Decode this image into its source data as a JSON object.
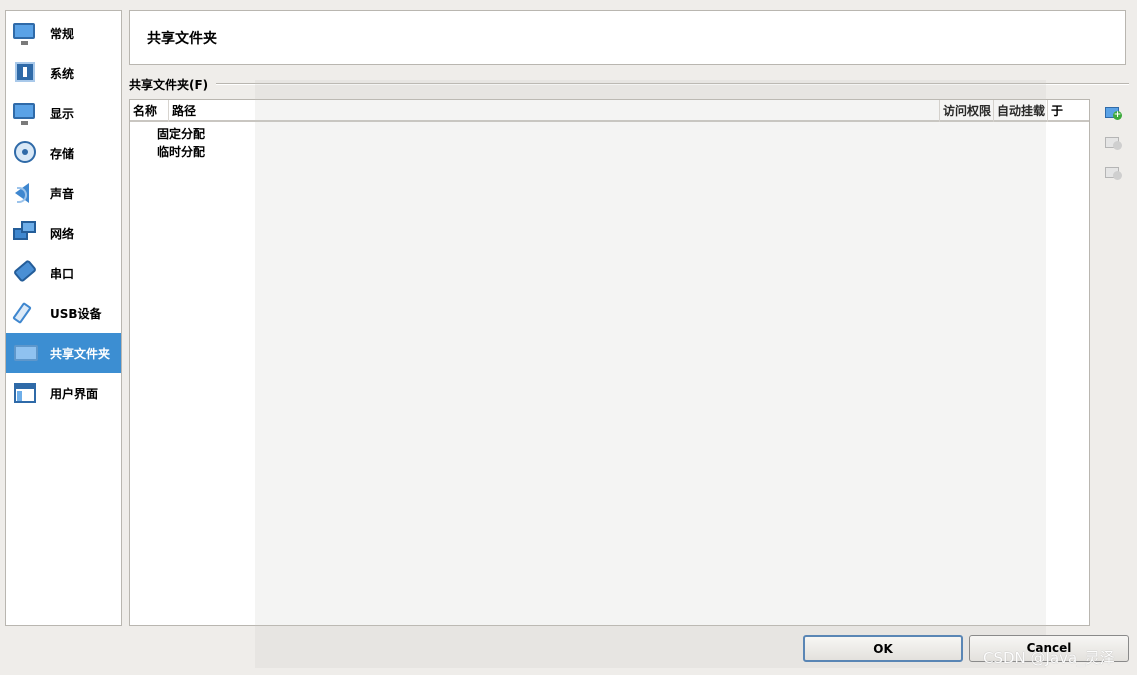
{
  "sidebar": {
    "items": [
      {
        "label": "常规",
        "icon": "monitor-icon"
      },
      {
        "label": "系统",
        "icon": "chip-icon"
      },
      {
        "label": "显示",
        "icon": "display-icon"
      },
      {
        "label": "存储",
        "icon": "disk-icon"
      },
      {
        "label": "声音",
        "icon": "speaker-icon"
      },
      {
        "label": "网络",
        "icon": "network-icon"
      },
      {
        "label": "串口",
        "icon": "serial-port-icon"
      },
      {
        "label": "USB设备",
        "icon": "usb-icon"
      },
      {
        "label": "共享文件夹",
        "icon": "shared-folder-icon",
        "selected": true
      },
      {
        "label": "用户界面",
        "icon": "window-icon"
      }
    ],
    "active_color": "#3c8ed2"
  },
  "header": {
    "title": "共享文件夹"
  },
  "group": {
    "label": "共享文件夹(F)"
  },
  "table": {
    "columns": [
      "名称",
      "路径",
      "访问权限",
      "自动挂载",
      "于"
    ],
    "rows": [
      "固定分配",
      "临时分配"
    ]
  },
  "tools": {
    "add": "add-shared-folder-icon",
    "edit": "edit-shared-folder-icon",
    "remove": "remove-shared-folder-icon"
  },
  "buttons": {
    "ok": "OK",
    "cancel": "Cancel"
  },
  "watermark": "CSDN @Java_灵泽"
}
